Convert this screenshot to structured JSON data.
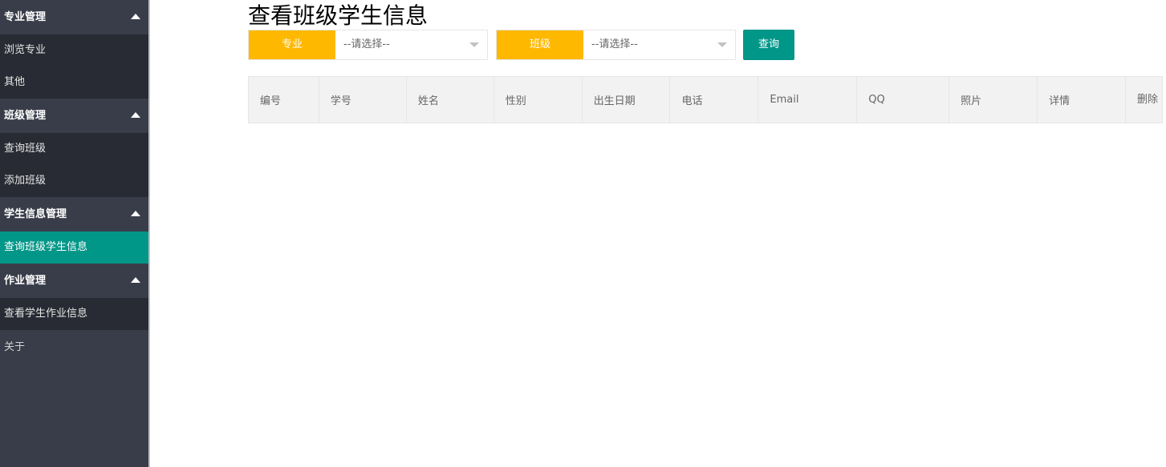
{
  "sidebar": {
    "groups": [
      {
        "title": "专业管理",
        "items": [
          "浏览专业",
          "其他"
        ]
      },
      {
        "title": "班级管理",
        "items": [
          "查询班级",
          "添加班级"
        ]
      },
      {
        "title": "学生信息管理",
        "items": [
          "查询班级学生信息"
        ]
      },
      {
        "title": "作业管理",
        "items": [
          "查看学生作业信息"
        ]
      }
    ],
    "about": "关于",
    "active_item": "查询班级学生信息"
  },
  "main": {
    "title": "查看班级学生信息",
    "filters": {
      "major_label": "专业",
      "major_value": "--请选择--",
      "class_label": "班级",
      "class_value": "--请选择--",
      "query_button": "查询"
    },
    "table": {
      "headers": [
        "编号",
        "学号",
        "姓名",
        "性别",
        "出生日期",
        "电话",
        "Email",
        "QQ",
        "照片",
        "详情",
        "删除"
      ]
    }
  },
  "colors": {
    "sidebar_bg": "#393d49",
    "sidebar_child_bg": "#282b33",
    "active": "#009688",
    "label_bg": "#ffb800",
    "header_bg": "#f2f2f2"
  }
}
